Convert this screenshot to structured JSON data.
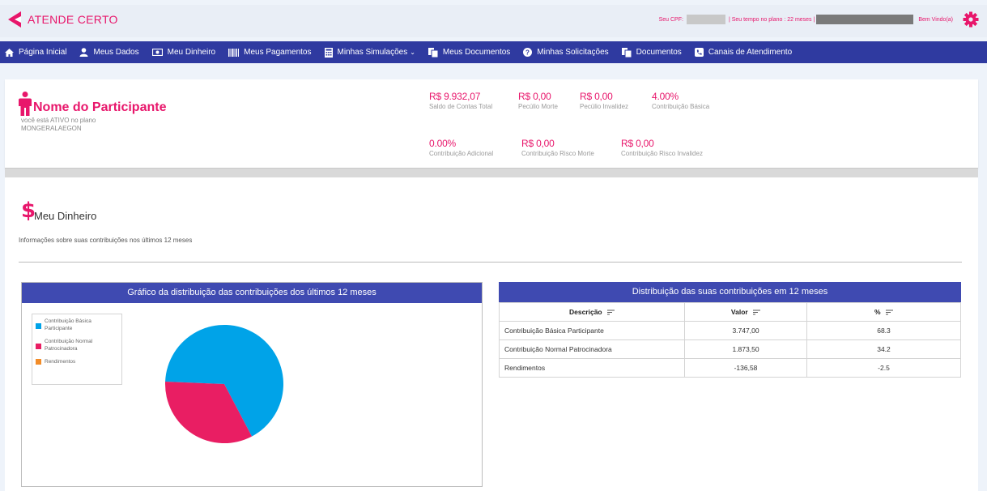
{
  "header": {
    "app_title": "ATENDE CERTO",
    "cpf_label": "Seu CPF:",
    "plan_time": "| Seu tempo no plano : 22 meses |",
    "welcome": "Bem Vindo(a)"
  },
  "nav": {
    "items": [
      {
        "label": "Página Inicial",
        "icon": "home-icon"
      },
      {
        "label": "Meus Dados",
        "icon": "user-icon"
      },
      {
        "label": "Meu Dinheiro",
        "icon": "money-icon"
      },
      {
        "label": "Meus Pagamentos",
        "icon": "barcode-icon"
      },
      {
        "label": "Minhas Simulações",
        "icon": "calculator-icon"
      },
      {
        "label": "Meus Documentos",
        "icon": "documents-icon"
      },
      {
        "label": "Minhas Solicitações",
        "icon": "question-icon"
      },
      {
        "label": "Documentos",
        "icon": "documents-icon"
      },
      {
        "label": "Canais de Atendimento",
        "icon": "phone-icon"
      }
    ]
  },
  "participant": {
    "name": "Nome do Participante",
    "status_line": "você está ATIVO no plano",
    "plan": "MONGERALAEGON",
    "stats": [
      {
        "value": "R$ 9.932,07",
        "label": "Saldo de Contas Total"
      },
      {
        "value": "R$ 0,00",
        "label": "Pecúlio Morte"
      },
      {
        "value": "R$ 0,00",
        "label": "Pecúlio Invalidez"
      },
      {
        "value": "4.00%",
        "label": "Contribuição Básica"
      },
      {
        "value": "0.00%",
        "label": "Contribuição Adicional"
      },
      {
        "value": "R$ 0,00",
        "label": "Contribuição Risco Morte"
      },
      {
        "value": "R$ 0,00",
        "label": "Contribuição Risco Invalidez"
      }
    ]
  },
  "section": {
    "title": "Meu Dinheiro",
    "description": "Informações sobre suas contribuições nos últimos 12 meses"
  },
  "chart_panel": {
    "title": "Gráfico da distribuição das contribuições dos últimos 12 meses"
  },
  "chart_data": {
    "type": "pie",
    "title": "Gráfico da distribuição das contribuições dos últimos 12 meses",
    "legend_position": "top-left",
    "slices": [
      {
        "label": "Contribuição Básica Participante",
        "value": 68.3,
        "color": "#00a3e8"
      },
      {
        "label": "Contribuição Normal Patrocinadora",
        "value": 34.2,
        "color": "#e91e63"
      },
      {
        "label": "Rendimentos",
        "value": -2.5,
        "color": "#f28c28"
      }
    ]
  },
  "legend": {
    "items": [
      {
        "line1": "Contribuição Básica",
        "line2": "Participante",
        "color": "#00a3e8"
      },
      {
        "line1": "Contribuição Normal",
        "line2": "Patrocinadora",
        "color": "#e91e63"
      },
      {
        "line1": "Rendimentos",
        "line2": "",
        "color": "#f28c28"
      }
    ]
  },
  "table": {
    "title": "Distribuição das suas contribuições em 12 meses",
    "columns": [
      "Descrição",
      "Valor",
      "%"
    ],
    "rows": [
      [
        "Contribuição Básica Participante",
        "3.747,00",
        "68.3"
      ],
      [
        "Contribuição Normal Patrocinadora",
        "1.873,50",
        "34.2"
      ],
      [
        "Rendimentos",
        "-136,58",
        "-2.5"
      ]
    ]
  },
  "colors": {
    "brand_pink": "#e8166b",
    "nav_blue": "#2f3aa0",
    "panel_blue": "#3f4ab1"
  }
}
